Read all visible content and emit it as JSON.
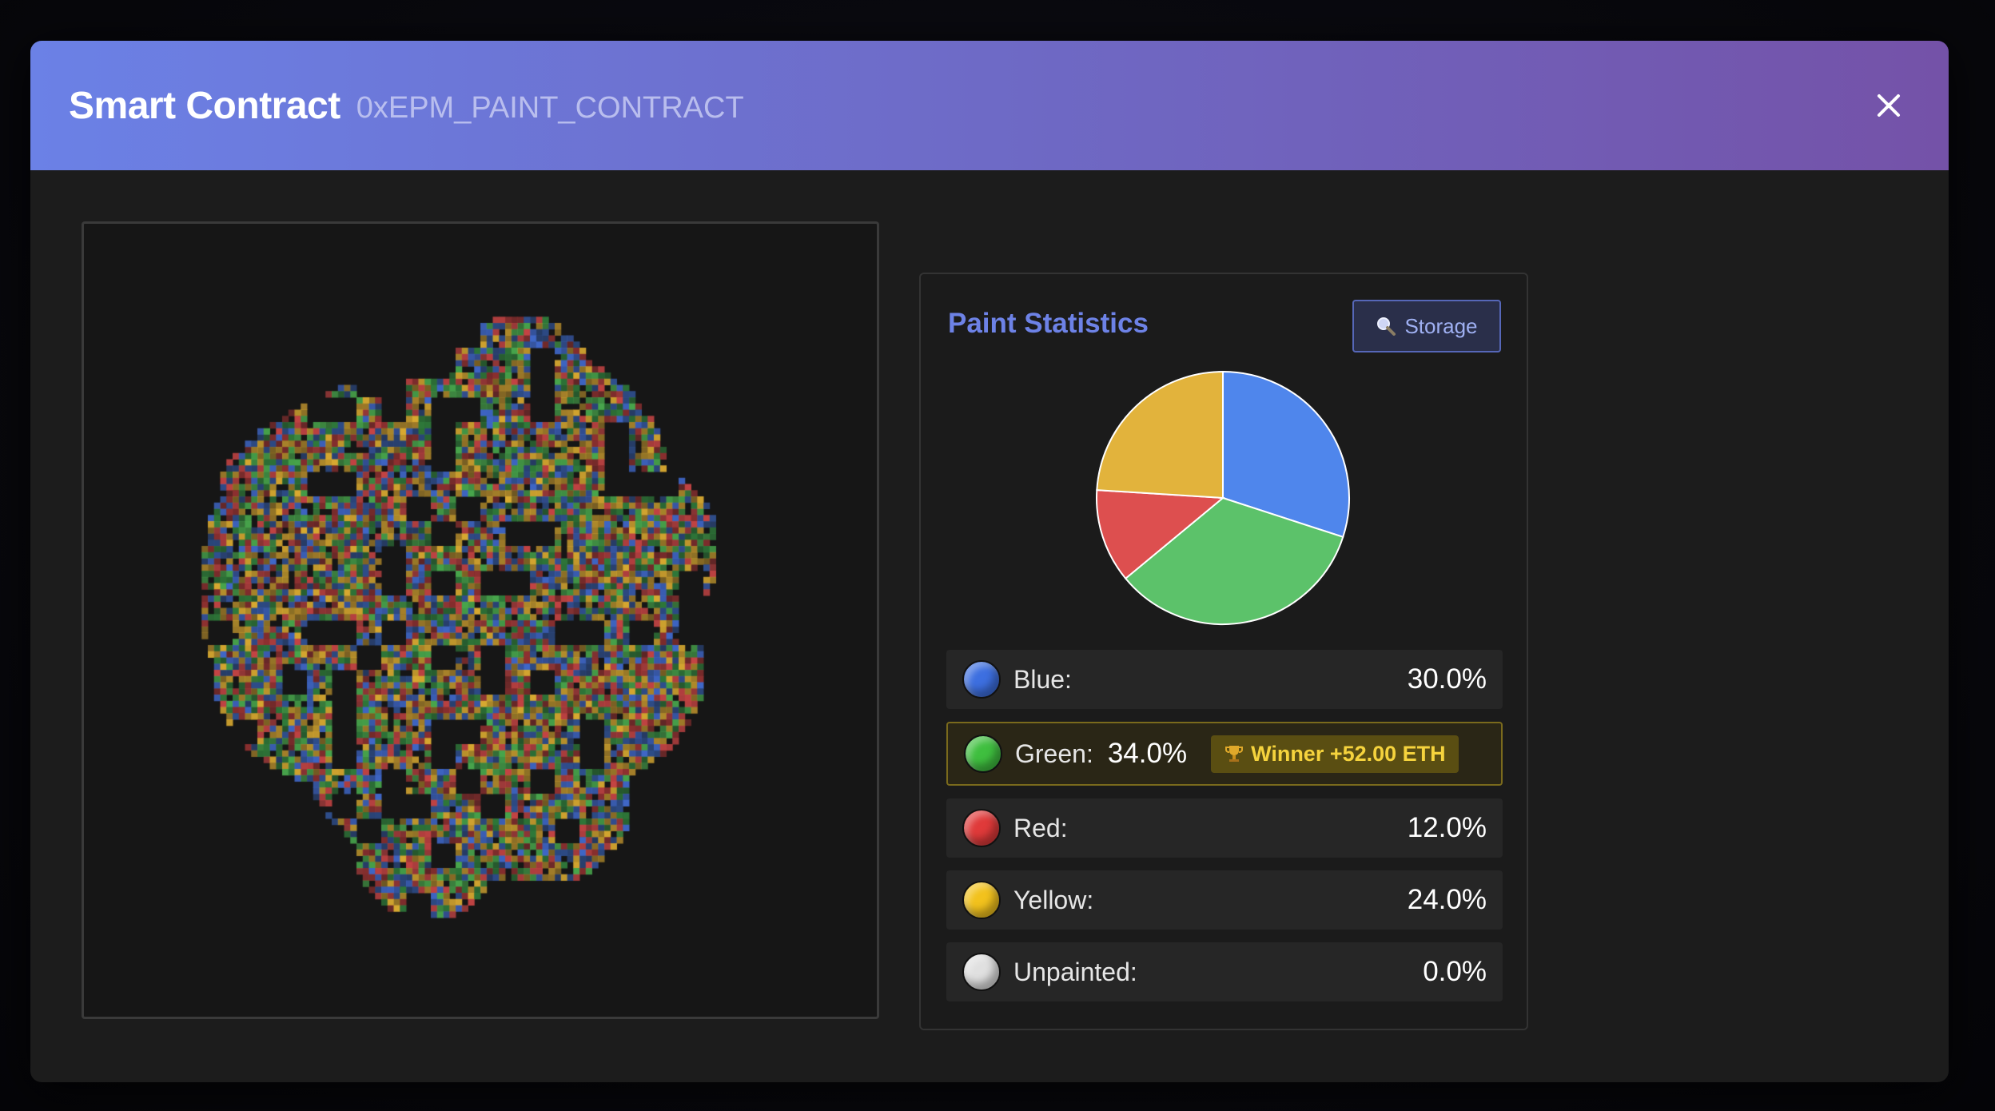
{
  "modal": {
    "title": "Smart Contract",
    "subtitle": "0xEPM_PAINT_CONTRACT"
  },
  "stats": {
    "title": "Paint Statistics",
    "storage_label": "Storage",
    "storage_icon": "magnifier-icon",
    "winner_badge": "Winner +52.00 ETH",
    "winner_icon": "trophy-icon",
    "rows": [
      {
        "label": "Blue:",
        "value": "30.0%",
        "color": "#3d6fe0"
      },
      {
        "label": "Green:",
        "value": "34.0%",
        "color": "#3fbf3f"
      },
      {
        "label": "Red:",
        "value": "12.0%",
        "color": "#e03a3a"
      },
      {
        "label": "Yellow:",
        "value": "24.0%",
        "color": "#f2c21d"
      },
      {
        "label": "Unpainted:",
        "value": "0.0%",
        "color": "#e0e0e0"
      }
    ]
  },
  "chart_data": {
    "type": "pie",
    "categories": [
      "Blue",
      "Green",
      "Red",
      "Yellow",
      "Unpainted"
    ],
    "values": [
      30.0,
      34.0,
      12.0,
      24.0,
      0.0
    ],
    "colors": [
      "#4f86ec",
      "#5cc26a",
      "#dd4f4f",
      "#e2b33c",
      "#e0e0e0"
    ]
  },
  "colors": {
    "header_start": "#6b81e6",
    "header_end": "#7452a8",
    "accent": "#6d82e6",
    "winner_gold": "#f5d33d"
  }
}
